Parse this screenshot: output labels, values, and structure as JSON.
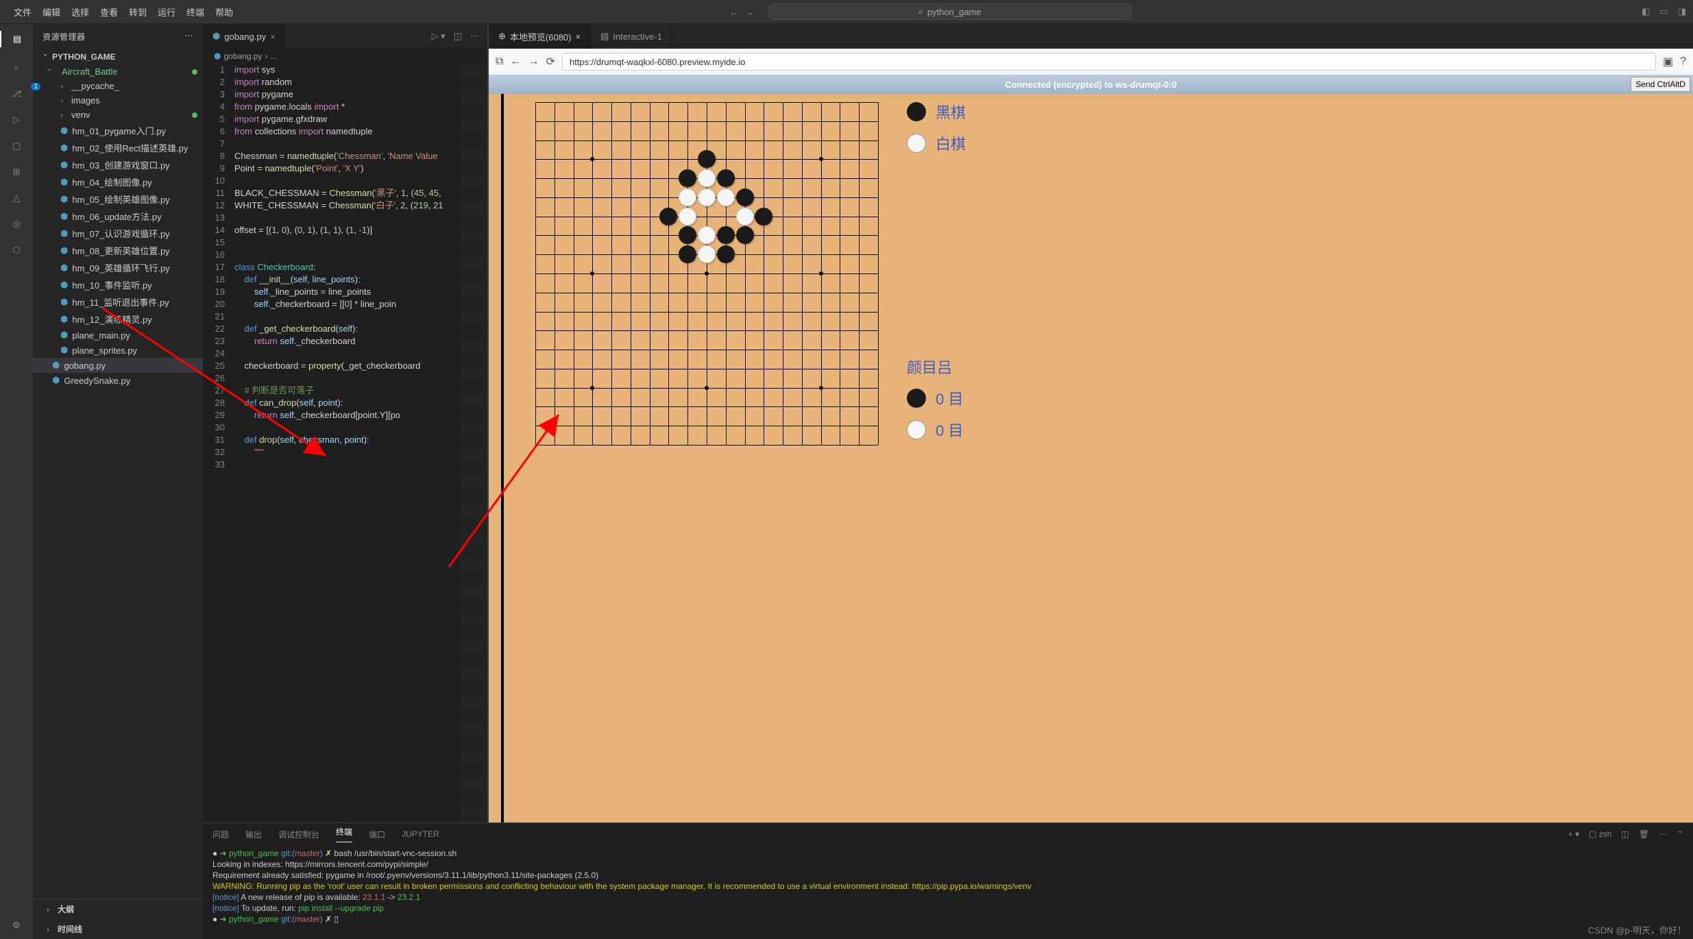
{
  "menu": {
    "file": "文件",
    "edit": "编辑",
    "select": "选择",
    "view": "查看",
    "goto": "转到",
    "run": "运行",
    "terminal": "终端",
    "help": "帮助"
  },
  "search_placeholder": "python_game",
  "sidebar": {
    "title": "资源管理器",
    "project": "PYTHON_GAME",
    "folders": {
      "aircraft": "Aircraft_Battle",
      "pycache": "__pycache_",
      "images": "images",
      "venv": "venv"
    },
    "files": {
      "f1": "hm_01_pygame入门.py",
      "f2": "hm_02_使用Rect描述英雄.py",
      "f3": "hm_03_创建游戏窗口.py",
      "f4": "hm_04_绘制图像.py",
      "f5": "hm_05_绘制英雄图像.py",
      "f6": "hm_06_update方法.py",
      "f7": "hm_07_认识游戏循环.py",
      "f8": "hm_08_更新英雄位置.py",
      "f9": "hm_09_英雄循环飞行.py",
      "f10": "hm_10_事件监听.py",
      "f11": "hm_11_监听退出事件.py",
      "f12": "hm_12_演练精灵.py",
      "f13": "plane_main.py",
      "f14": "plane_sprites.py",
      "gob": "gobang.py",
      "greed": "GreedySnake.py"
    },
    "outline": "大纲",
    "timeline": "时间线"
  },
  "editor": {
    "tab_title": "gobang.py",
    "breadcrumb_root": "gobang.py",
    "breadcrumb_sep": "› ..."
  },
  "code_lines": [
    "1",
    "2",
    "3",
    "4",
    "5",
    "6",
    "7",
    "8",
    "9",
    "10",
    "11",
    "12",
    "13",
    "14",
    "15",
    "16",
    "17",
    "18",
    "19",
    "20",
    "21",
    "22",
    "23",
    "24",
    "25",
    "26",
    "27",
    "28",
    "29",
    "30",
    "31",
    "32",
    "33"
  ],
  "preview": {
    "tab1": "本地预览(6080)",
    "tab2": "Interactive-1",
    "url": "https://drumqt-waqkxl-6080.preview.myide.io",
    "status": "Connected (encrypted) to ws-drumqt-0:0",
    "send_btn": "Send CtrlAltD"
  },
  "game": {
    "label1": "黑棋",
    "label2": "白棋",
    "label3": "颜目吕",
    "score_black": "0 目",
    "score_white": "0 目"
  },
  "panel": {
    "tabs": {
      "problems": "问题",
      "output": "输出",
      "debug": "调试控制台",
      "terminal": "终端",
      "ports": "端口",
      "jupyter": "JUPYTER"
    },
    "shell": "zsh"
  },
  "terminal": {
    "prompt_prefix": "➜  python_game ",
    "git_prefix": "git:(",
    "branch": "master",
    "git_suffix": ") ",
    "x": "✗ ",
    "cmd1": "bash /usr/bin/start-vnc-session.sh",
    "line2": "Looking in indexes: https://mirrors.tencent.com/pypi/simple/",
    "line3": "Requirement already satisfied: pygame in /root/.pyenv/versions/3.11.1/lib/python3.11/site-packages (2.5.0)",
    "warn": "WARNING: Running pip as the 'root' user can result in broken permissions and conflicting behaviour with the system package manager. It is recommended to use a virtual environment instead: https://pip.pypa.io/warnings/venv",
    "notice1_a": "[notice]",
    "notice1_b": " A new release of pip is available: ",
    "notice1_c": "23.1.1",
    "notice1_d": " -> ",
    "notice1_e": "23.2.1",
    "notice2_a": "[notice]",
    "notice2_b": " To update, run: ",
    "notice2_c": "pip install --upgrade pip",
    "cmd2_cursor": "▯"
  },
  "watermark": "CSDN @p-明天，你好！",
  "chart_data": {
    "type": "goboard",
    "board_size": 19,
    "black_stones": [
      [
        9,
        3
      ],
      [
        8,
        4
      ],
      [
        10,
        4
      ],
      [
        11,
        5
      ],
      [
        7,
        6
      ],
      [
        12,
        6
      ],
      [
        8,
        7
      ],
      [
        10,
        7
      ],
      [
        11,
        7
      ],
      [
        8,
        8
      ],
      [
        10,
        8
      ]
    ],
    "white_stones": [
      [
        9,
        4
      ],
      [
        8,
        5
      ],
      [
        9,
        5
      ],
      [
        10,
        5
      ],
      [
        8,
        6
      ],
      [
        11,
        6
      ],
      [
        9,
        7
      ],
      [
        9,
        8
      ]
    ],
    "star_points": [
      [
        3,
        3
      ],
      [
        9,
        3
      ],
      [
        15,
        3
      ],
      [
        3,
        9
      ],
      [
        9,
        9
      ],
      [
        15,
        9
      ],
      [
        3,
        15
      ],
      [
        9,
        15
      ],
      [
        15,
        15
      ]
    ]
  }
}
